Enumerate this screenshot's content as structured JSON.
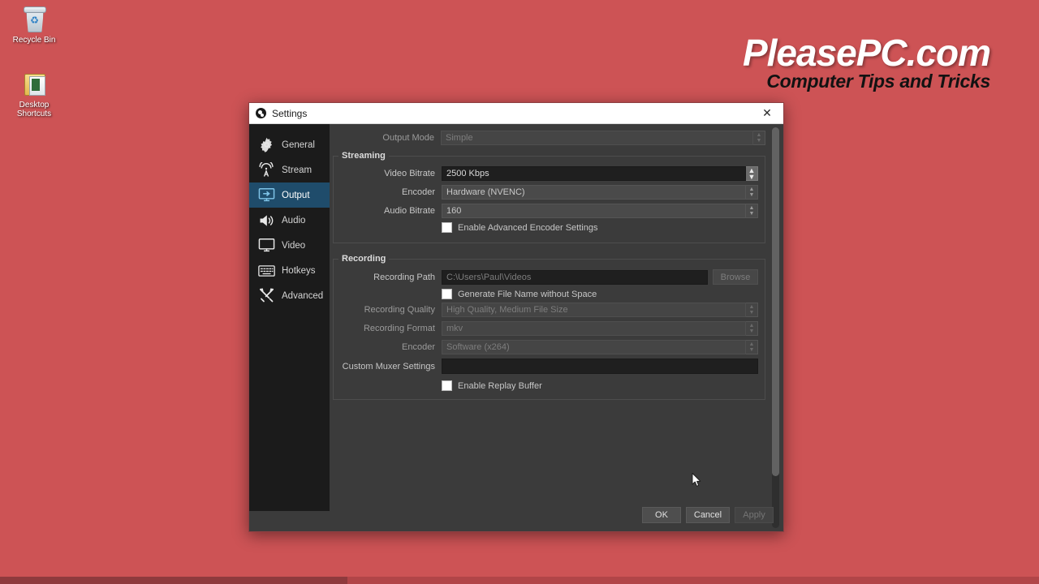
{
  "desktop": {
    "background_color": "#cd5355",
    "icons": [
      {
        "name": "recycle-bin",
        "label": "Recycle Bin"
      },
      {
        "name": "desktop-shortcuts",
        "label": "Desktop Shortcuts"
      }
    ]
  },
  "watermark": {
    "main": "PleasePC.com",
    "sub": "Computer Tips and Tricks",
    "main_color": "#ffffff",
    "sub_color": "#121212"
  },
  "window": {
    "title": "Settings",
    "close_label": "✕"
  },
  "sidebar": {
    "active": "Output",
    "active_color": "#1f4c6b",
    "items": [
      {
        "label": "General",
        "icon": "gear-icon"
      },
      {
        "label": "Stream",
        "icon": "broadcast-icon"
      },
      {
        "label": "Output",
        "icon": "output-monitor-icon"
      },
      {
        "label": "Audio",
        "icon": "speaker-icon"
      },
      {
        "label": "Video",
        "icon": "monitor-icon"
      },
      {
        "label": "Hotkeys",
        "icon": "keyboard-icon"
      },
      {
        "label": "Advanced",
        "icon": "tools-icon"
      }
    ]
  },
  "output_mode": {
    "label": "Output Mode",
    "value": "Simple",
    "disabled": true
  },
  "streaming": {
    "title": "Streaming",
    "video_bitrate": {
      "label": "Video Bitrate",
      "value": "2500 Kbps"
    },
    "encoder": {
      "label": "Encoder",
      "value": "Hardware (NVENC)"
    },
    "audio_bitrate": {
      "label": "Audio Bitrate",
      "value": "160"
    },
    "advanced_encoder": {
      "label": "Enable Advanced Encoder Settings",
      "checked": false
    }
  },
  "recording": {
    "title": "Recording",
    "path": {
      "label": "Recording Path",
      "value": "C:\\Users\\Paul\\Videos"
    },
    "browse_label": "Browse",
    "generate_filename": {
      "label": "Generate File Name without Space",
      "checked": false
    },
    "quality": {
      "label": "Recording Quality",
      "value": "High Quality, Medium File Size"
    },
    "format": {
      "label": "Recording Format",
      "value": "mkv"
    },
    "encoder": {
      "label": "Encoder",
      "value": "Software (x264)"
    },
    "muxer": {
      "label": "Custom Muxer Settings",
      "value": "",
      "placeholder": ""
    },
    "replay_buffer": {
      "label": "Enable Replay Buffer",
      "checked": false
    }
  },
  "footer": {
    "ok": "OK",
    "cancel": "Cancel",
    "apply": "Apply"
  }
}
